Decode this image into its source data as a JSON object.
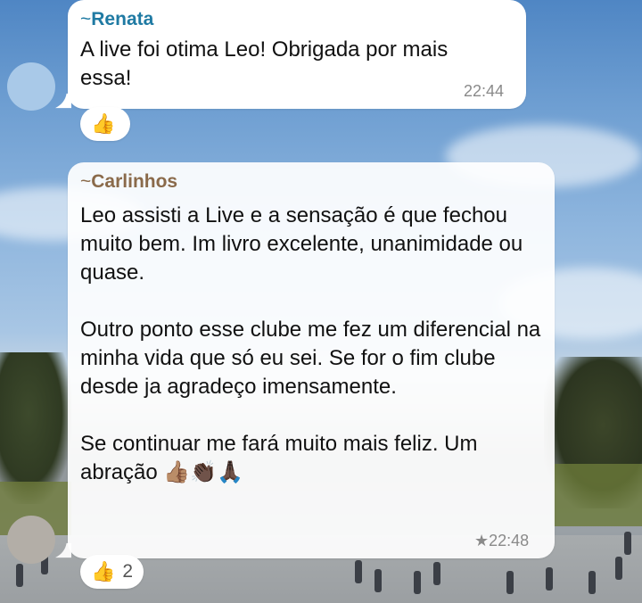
{
  "messages": [
    {
      "sender": "Renata",
      "sender_prefix": "~",
      "sender_color": "#1f7aa3",
      "text": "A live foi otima Leo! Obrigada por mais essa!",
      "time": "22:44",
      "reactions": {
        "emoji": "👍",
        "count": ""
      }
    },
    {
      "sender": "Carlinhos",
      "sender_prefix": "~",
      "sender_color": "#8a6a4a",
      "paragraphs": [
        "Leo assisti a Live e a sensação é que fechou muito bem. Im livro excelente, unanimidade ou quase.",
        "Outro ponto esse clube me fez um diferencial na minha vida que só eu sei. Se for o fim clube desde ja agradeço imensamente.",
        "Se continuar me fará muito mais feliz. Um abração 👍🏽👏🏿🙏🏿"
      ],
      "time": "22:48",
      "starred_icon": "★",
      "reactions": {
        "emoji": "👍",
        "count": "2"
      }
    }
  ],
  "avatars": {
    "renata_color": "#a9c9e8",
    "carlinhos_color": "#b3aea7"
  }
}
